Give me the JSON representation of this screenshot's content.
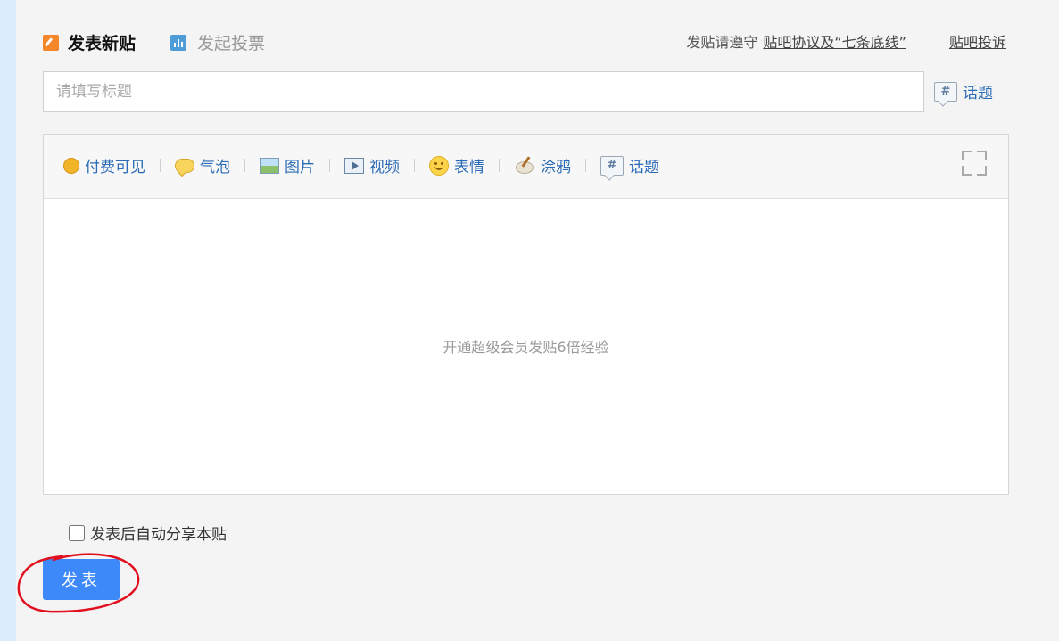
{
  "header": {
    "tab_new_post": "发表新贴",
    "tab_vote": "发起投票",
    "rules_prefix": "发贴请遵守",
    "rules_link": "贴吧协议及“七条底线”",
    "complain_link": "贴吧投诉"
  },
  "title_input": {
    "placeholder": "请填写标题",
    "value": ""
  },
  "topic_link": "话题",
  "toolbar": {
    "items": [
      {
        "label": "付费可见",
        "icon": "coin-icon"
      },
      {
        "label": "气泡",
        "icon": "bubble-icon"
      },
      {
        "label": "图片",
        "icon": "image-icon"
      },
      {
        "label": "视频",
        "icon": "video-icon"
      },
      {
        "label": "表情",
        "icon": "smiley-icon"
      },
      {
        "label": "涂鸦",
        "icon": "paint-brush-icon"
      },
      {
        "label": "话题",
        "icon": "hashtag-icon"
      }
    ],
    "fullscreen_icon": "fullscreen-icon"
  },
  "editor": {
    "placeholder": "开通超级会员发贴6倍经验"
  },
  "share_option": {
    "label": "发表后自动分享本贴",
    "checked": false
  },
  "submit_button": "发表",
  "colors": {
    "accent": "#3e89fa",
    "link": "#2b6bb5",
    "annotation": "#e0101e"
  }
}
